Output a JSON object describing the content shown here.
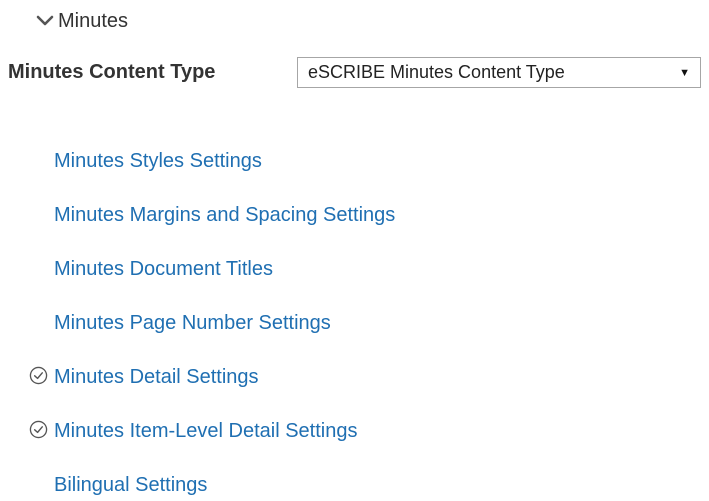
{
  "section": {
    "title": "Minutes",
    "chevron_icon": "chevron-down-icon"
  },
  "content_type": {
    "label": "Minutes Content Type",
    "selected": "eSCRIBE Minutes Content Type"
  },
  "settings_links": [
    {
      "label": "Minutes Styles Settings",
      "completed": false
    },
    {
      "label": "Minutes Margins and Spacing Settings",
      "completed": false
    },
    {
      "label": "Minutes Document Titles",
      "completed": false
    },
    {
      "label": "Minutes Page Number Settings",
      "completed": false
    },
    {
      "label": "Minutes Detail Settings",
      "completed": true,
      "icon": "check-circle-icon"
    },
    {
      "label": "Minutes Item-Level Detail Settings",
      "completed": true,
      "icon": "check-circle-icon"
    },
    {
      "label": "Bilingual Settings",
      "completed": false
    }
  ],
  "colors": {
    "link": "#1f6fb2",
    "text": "#333333",
    "border": "#a6a6a6"
  }
}
